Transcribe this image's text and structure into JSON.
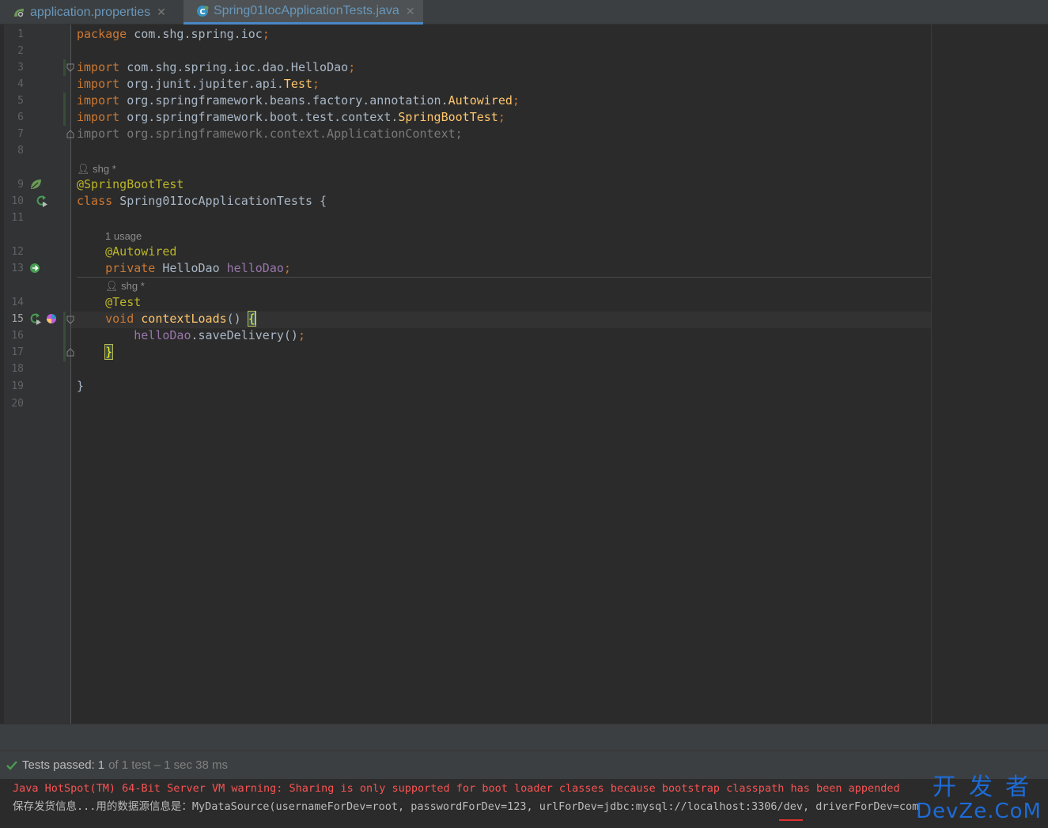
{
  "tabs": [
    {
      "label": "application.properties",
      "active": false
    },
    {
      "label": "Spring01IocApplicationTests.java",
      "active": true
    }
  ],
  "editor": {
    "lines": [
      {
        "n": "1",
        "tokens": [
          {
            "t": "package ",
            "c": "kw"
          },
          {
            "t": "com.shg.spring.ioc",
            "c": ""
          },
          {
            "t": ";",
            "c": "kw"
          }
        ]
      },
      {
        "n": "2",
        "tokens": []
      },
      {
        "n": "3",
        "tokens": [
          {
            "t": "import ",
            "c": "kw"
          },
          {
            "t": "com.shg.spring.ioc.dao.HelloDao",
            "c": ""
          },
          {
            "t": ";",
            "c": "kw"
          }
        ]
      },
      {
        "n": "4",
        "tokens": [
          {
            "t": "import ",
            "c": "kw"
          },
          {
            "t": "org.junit.jupiter.api.",
            "c": ""
          },
          {
            "t": "Test",
            "c": "mth"
          },
          {
            "t": ";",
            "c": "kw"
          }
        ]
      },
      {
        "n": "5",
        "tokens": [
          {
            "t": "import ",
            "c": "kw"
          },
          {
            "t": "org.springframework.beans.factory.annotation.",
            "c": ""
          },
          {
            "t": "Autowired",
            "c": "mth"
          },
          {
            "t": ";",
            "c": "kw"
          }
        ]
      },
      {
        "n": "6",
        "tokens": [
          {
            "t": "import ",
            "c": "kw"
          },
          {
            "t": "org.springframework.boot.test.context.",
            "c": ""
          },
          {
            "t": "SpringBootTest",
            "c": "mth"
          },
          {
            "t": ";",
            "c": "kw"
          }
        ]
      },
      {
        "n": "7",
        "tokens": [
          {
            "t": "import org.springframework.context.ApplicationContext;",
            "c": "dim"
          }
        ]
      },
      {
        "n": "8",
        "tokens": []
      },
      {
        "n": "9",
        "tokens": [
          {
            "t": "@SpringBootTest",
            "c": "ann"
          }
        ]
      },
      {
        "n": "10",
        "tokens": [
          {
            "t": "class ",
            "c": "kw"
          },
          {
            "t": "Spring01IocApplicationTests {",
            "c": ""
          }
        ]
      },
      {
        "n": "11",
        "tokens": []
      },
      {
        "n": "12",
        "tokens": [
          {
            "t": "    ",
            "c": ""
          },
          {
            "t": "@Autowired",
            "c": "ann"
          }
        ]
      },
      {
        "n": "13",
        "tokens": [
          {
            "t": "    ",
            "c": ""
          },
          {
            "t": "private ",
            "c": "kw"
          },
          {
            "t": "HelloDao ",
            "c": ""
          },
          {
            "t": "helloDao",
            "c": "fld"
          },
          {
            "t": ";",
            "c": "kw"
          }
        ]
      },
      {
        "n": "14",
        "tokens": [
          {
            "t": "    ",
            "c": ""
          },
          {
            "t": "@Test",
            "c": "ann"
          }
        ]
      },
      {
        "n": "15",
        "tokens": [
          {
            "t": "    ",
            "c": ""
          },
          {
            "t": "void ",
            "c": "kw"
          },
          {
            "t": "contextLoads",
            "c": "mth"
          },
          {
            "t": "() ",
            "c": ""
          },
          {
            "t": "{",
            "c": "brace"
          }
        ]
      },
      {
        "n": "16",
        "tokens": [
          {
            "t": "        ",
            "c": ""
          },
          {
            "t": "helloDao",
            "c": "fld"
          },
          {
            "t": ".saveDelivery()",
            "c": ""
          },
          {
            "t": ";",
            "c": "kw"
          }
        ]
      },
      {
        "n": "17",
        "tokens": [
          {
            "t": "    ",
            "c": ""
          },
          {
            "t": "}",
            "c": "brace"
          }
        ]
      },
      {
        "n": "18",
        "tokens": []
      },
      {
        "n": "19",
        "tokens": [
          {
            "t": "}",
            "c": ""
          }
        ]
      },
      {
        "n": "20",
        "tokens": []
      }
    ],
    "hints": {
      "class_author": "shg *",
      "field_usage": "1 usage",
      "method_author": "shg *"
    }
  },
  "tests": {
    "passed_label": "Tests passed:",
    "passed_count": "1",
    "detail": "of 1 test – 1 sec 38 ms"
  },
  "console": {
    "warning": "Java HotSpot(TM) 64-Bit Server VM warning: Sharing is only supported for boot loader classes because bootstrap classpath has been appended",
    "output": "保存发货信息...用的数据源信息是：MyDataSource(usernameForDev=root, passwordForDev=123, urlForDev=jdbc:mysql://localhost:3306/dev, driverForDev=com"
  },
  "watermark": {
    "line1": "开发者",
    "line2": "DevZe.CoM"
  },
  "colors": {
    "keyword": "#cc7832",
    "annotation": "#bbb529",
    "field": "#9876aa",
    "method": "#ffc66d",
    "warning": "#f95353",
    "pass": "#499c54"
  }
}
